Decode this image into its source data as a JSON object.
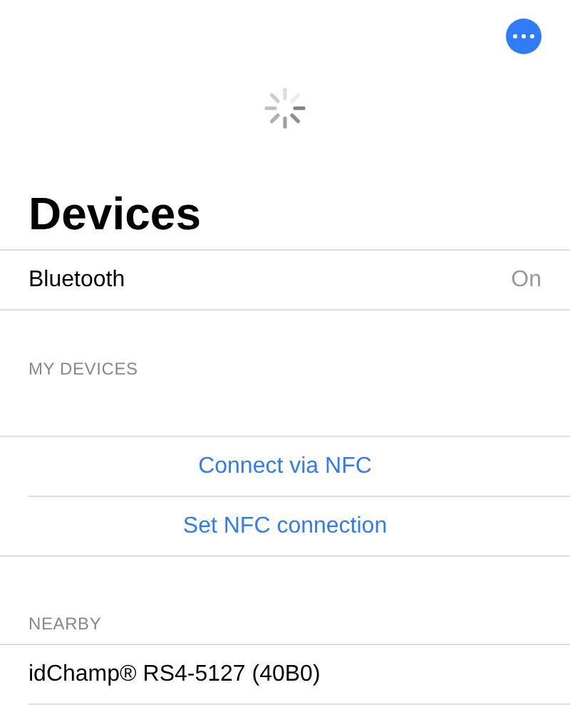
{
  "title": "Devices",
  "bluetooth": {
    "label": "Bluetooth",
    "value": "On"
  },
  "sections": [
    {
      "header": "MY DEVICES",
      "rows": [
        {
          "kind": "action",
          "label": "Connect via NFC"
        },
        {
          "kind": "action",
          "label": "Set NFC connection"
        }
      ]
    },
    {
      "header": "NEARBY",
      "rows": [
        {
          "kind": "device",
          "label": "idChamp® RS4-5127 (40B0)"
        }
      ]
    }
  ]
}
